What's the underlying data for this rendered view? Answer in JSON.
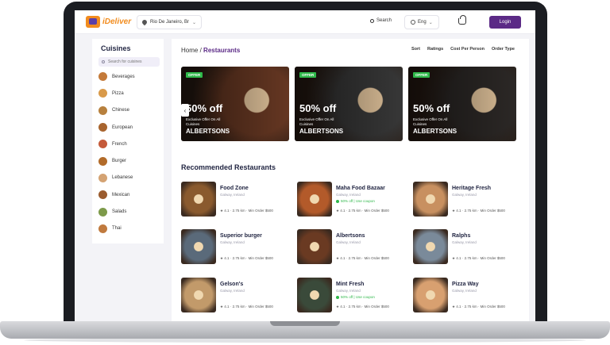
{
  "brand": {
    "name": "iDeliver",
    "accent": "#5b2a86",
    "logo_color": "#f28c1e"
  },
  "header": {
    "location": "Rio De Janeiro, Br",
    "search_label": "Search",
    "language": "Eng",
    "login_label": "Login"
  },
  "sidebar": {
    "title": "Cuisines",
    "search_placeholder": "Search for cuisines",
    "items": [
      {
        "label": "Beverages",
        "color": "#c47a3a"
      },
      {
        "label": "Pizza",
        "color": "#d99a4a"
      },
      {
        "label": "Chinese",
        "color": "#b7803e"
      },
      {
        "label": "European",
        "color": "#a8642e"
      },
      {
        "label": "French",
        "color": "#c55a3a"
      },
      {
        "label": "Burger",
        "color": "#b26b2a"
      },
      {
        "label": "Lebanese",
        "color": "#d4a373"
      },
      {
        "label": "Mexican",
        "color": "#9a5b2e"
      },
      {
        "label": "Salads",
        "color": "#7d9a4a"
      },
      {
        "label": "Thai",
        "color": "#c07a3e"
      }
    ]
  },
  "main": {
    "breadcrumb_home": "Home",
    "breadcrumb_sep": "/",
    "breadcrumb_current": "Restaurants",
    "filters": [
      "Sort",
      "Ratings",
      "Cost Per Person",
      "Order Type"
    ],
    "section_title": "Recommended Restaurants"
  },
  "offers": [
    {
      "tag": "OFFER",
      "title": "50% off",
      "subtitle": "Exclusive Offer On All Cuisines",
      "name": "ALBERTSONS",
      "color": "#6b3a24"
    },
    {
      "tag": "OFFER",
      "title": "50% off",
      "subtitle": "Exclusive Offer On All Cuisines",
      "name": "ALBERTSONS",
      "color": "#3a3a3a"
    },
    {
      "tag": "OFFER",
      "title": "50% off",
      "subtitle": "Exclusive Offer On All Cuisines",
      "name": "ALBERTSONS",
      "color": "#2e2a28"
    }
  ],
  "restaurants": [
    {
      "name": "Food Zone",
      "location": "Galway, Ireland",
      "offer": "",
      "rating": "4.1",
      "distance": "2.75 km",
      "min_order": "Min Order $500",
      "color": "#8a5a2e"
    },
    {
      "name": "Maha Food Bazaar",
      "location": "Galway, Ireland",
      "offer": "50% off | Use coupon",
      "rating": "4.1",
      "distance": "2.75 km",
      "min_order": "Min Order $500",
      "color": "#b35a2a"
    },
    {
      "name": "Heritage Fresh",
      "location": "Galway, Ireland",
      "offer": "",
      "rating": "4.1",
      "distance": "2.75 km",
      "min_order": "Min Order $500",
      "color": "#c89060"
    },
    {
      "name": "Superior burger",
      "location": "Galway, Ireland",
      "offer": "",
      "rating": "4.1",
      "distance": "2.75 km",
      "min_order": "Min Order $500",
      "color": "#5a6a7a"
    },
    {
      "name": "Albertsons",
      "location": "Galway, Ireland",
      "offer": "",
      "rating": "4.1",
      "distance": "2.75 km",
      "min_order": "Min Order $500",
      "color": "#6a3a22"
    },
    {
      "name": "Ralphs",
      "location": "Galway, Ireland",
      "offer": "",
      "rating": "4.1",
      "distance": "2.75 km",
      "min_order": "Min Order $500",
      "color": "#7a8a9a"
    },
    {
      "name": "Gelson's",
      "location": "Galway, Ireland",
      "offer": "",
      "rating": "4.1",
      "distance": "2.75 km",
      "min_order": "Min Order $500",
      "color": "#c29a6a"
    },
    {
      "name": "Mint Fresh",
      "location": "Galway, Ireland",
      "offer": "50% off | Use coupon",
      "rating": "4.1",
      "distance": "2.75 km",
      "min_order": "Min Order $500",
      "color": "#3a4a3a"
    },
    {
      "name": "Pizza Way",
      "location": "Galway, Ireland",
      "offer": "",
      "rating": "4.1",
      "distance": "2.75 km",
      "min_order": "Min Order $500",
      "color": "#d8a070"
    }
  ]
}
